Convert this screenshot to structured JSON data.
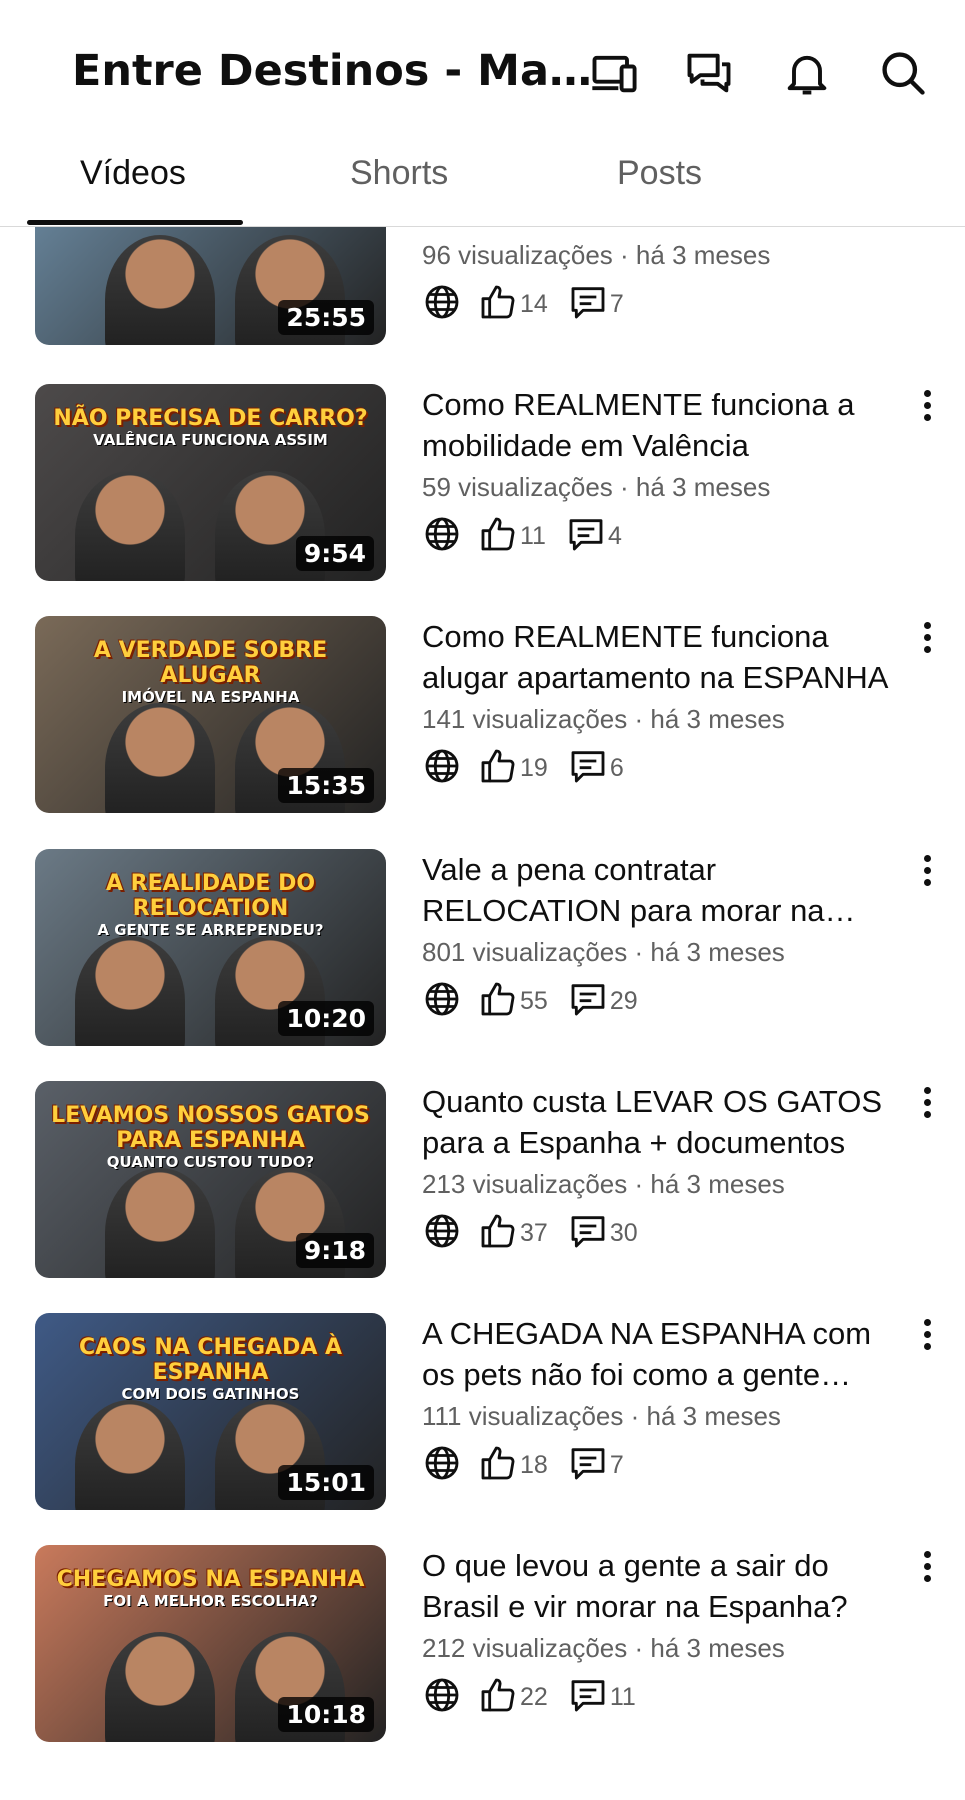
{
  "header": {
    "title": "Entre Destinos - Marcus Vinicius",
    "icons": [
      "cast-icon",
      "messages-icon",
      "bell-icon",
      "search-icon"
    ]
  },
  "tabs": [
    {
      "label": "Vídeos",
      "active": true
    },
    {
      "label": "Shorts",
      "active": false
    },
    {
      "label": "Posts",
      "active": false
    }
  ],
  "videos": [
    {
      "title": "",
      "views": "96 visualizações",
      "age": "há 3 meses",
      "likes": "14",
      "comments": "7",
      "duration": "25:55",
      "thumb_text": "",
      "thumb_bg": "#6f8fa8"
    },
    {
      "title": "Como REALMENTE funciona a mobilidade em Valência",
      "views": "59 visualizações",
      "age": "há 3 meses",
      "likes": "11",
      "comments": "4",
      "duration": "9:54",
      "thumb_text": "NÃO PRECISA DE CARRO?",
      "thumb_sub": "VALÊNCIA FUNCIONA ASSIM",
      "thumb_bg": "#4d4a4a"
    },
    {
      "title": "Como REALMENTE funciona alugar apartamento na ESPANHA",
      "views": "141 visualizações",
      "age": "há 3 meses",
      "likes": "19",
      "comments": "6",
      "duration": "15:35",
      "thumb_text": "A VERDADE SOBRE ALUGAR",
      "thumb_sub": "IMÓVEL NA ESPANHA",
      "thumb_bg": "#7a6a58"
    },
    {
      "title": "Vale a pena contratar RELOCATION para morar na Espanha?",
      "views": "801 visualizações",
      "age": "há 3 meses",
      "likes": "55",
      "comments": "29",
      "duration": "10:20",
      "thumb_text": "A REALIDADE DO RELOCATION",
      "thumb_sub": "A GENTE SE ARREPENDEU?",
      "thumb_bg": "#6b7a86"
    },
    {
      "title": "Quanto custa LEVAR OS GATOS para a Espanha + documentos",
      "views": "213 visualizações",
      "age": "há 3 meses",
      "likes": "37",
      "comments": "30",
      "duration": "9:18",
      "thumb_text": "LEVAMOS NOSSOS GATOS PARA ESPANHA",
      "thumb_sub": "QUANTO CUSTOU TUDO?",
      "thumb_bg": "#5a6068"
    },
    {
      "title": "A CHEGADA NA ESPANHA com os pets não foi como a gente esperava",
      "views": "111 visualizações",
      "age": "há 3 meses",
      "likes": "18",
      "comments": "7",
      "duration": "15:01",
      "thumb_text": "CAOS NA CHEGADA À ESPANHA",
      "thumb_sub": "COM DOIS GATINHOS",
      "thumb_bg": "#3f5a86"
    },
    {
      "title": "O que levou a gente a sair do Brasil e vir morar na Espanha?",
      "views": "212 visualizações",
      "age": "há 3 meses",
      "likes": "22",
      "comments": "11",
      "duration": "10:18",
      "thumb_text": "CHEGAMOS NA ESPANHA",
      "thumb_sub": "FOI A MELHOR ESCOLHA?",
      "thumb_bg": "#c97a5c"
    }
  ],
  "separator": "·"
}
